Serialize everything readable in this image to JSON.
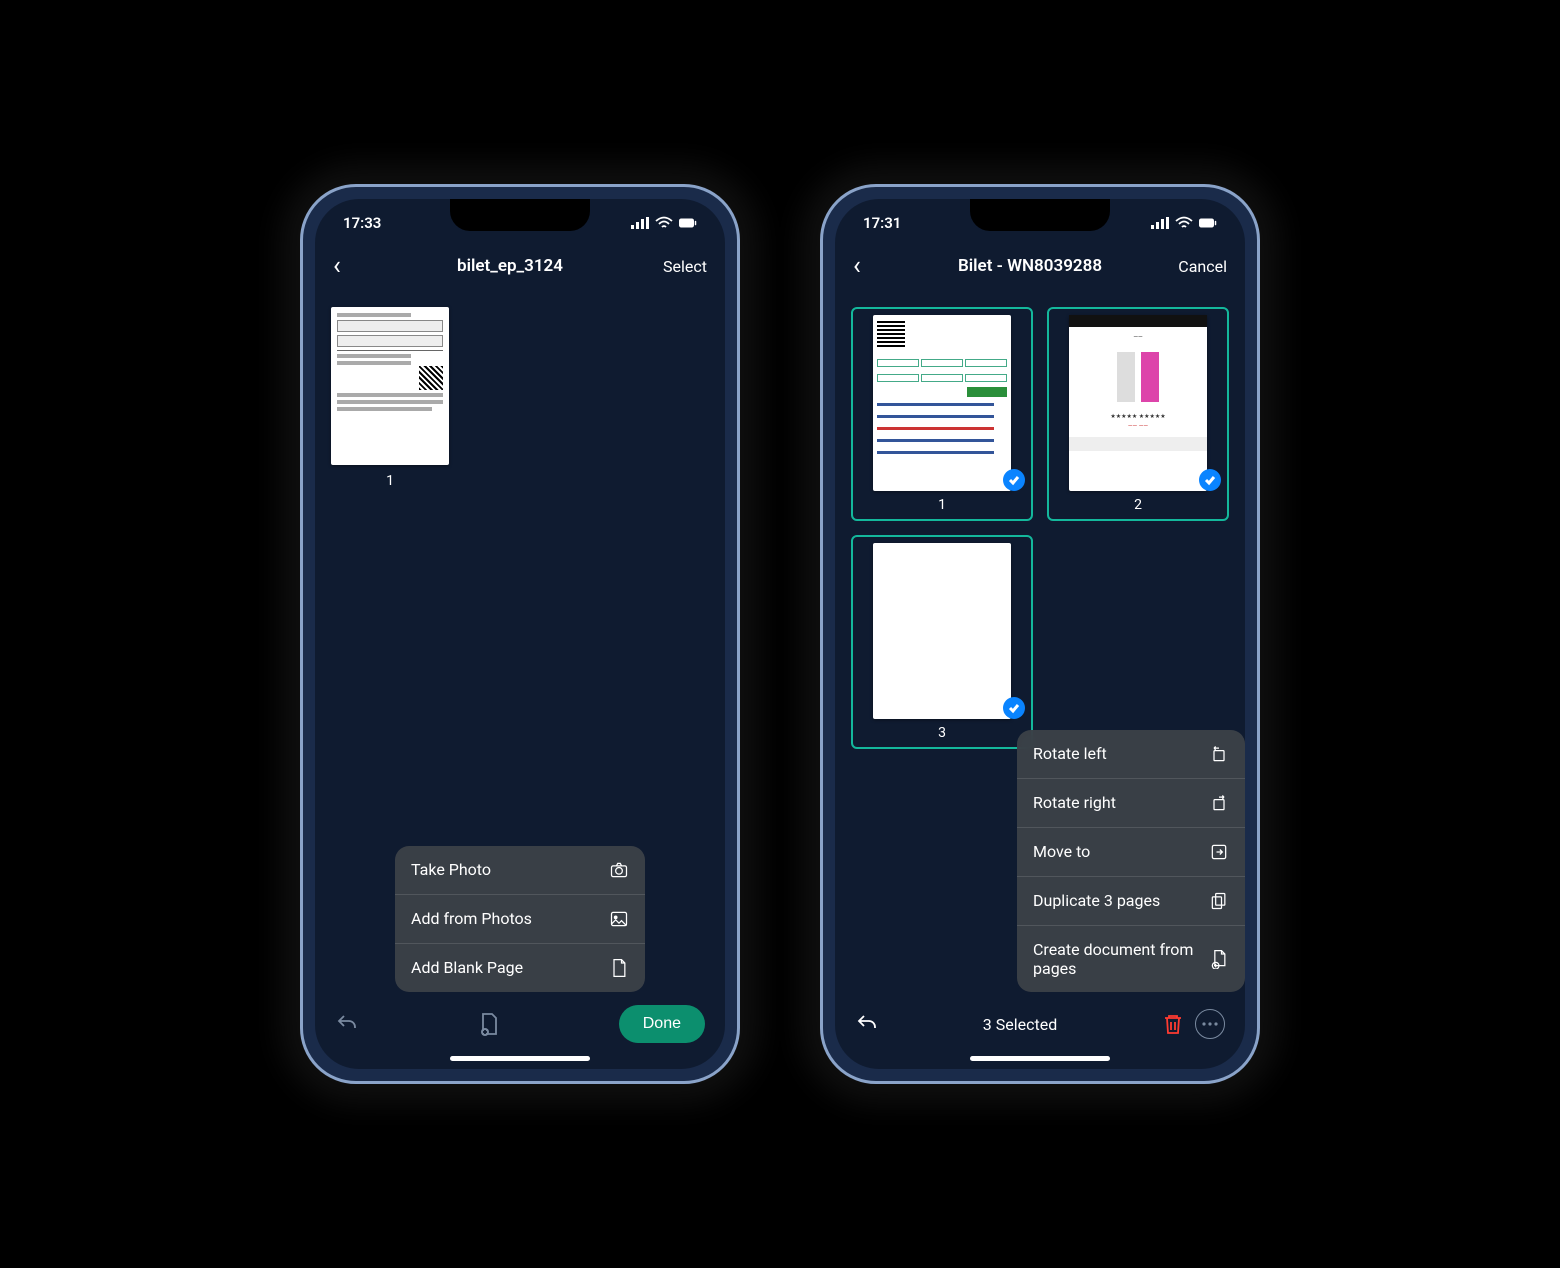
{
  "left": {
    "status": {
      "time": "17:33"
    },
    "nav": {
      "title": "bilet_ep_3124",
      "action": "Select"
    },
    "pages": [
      {
        "index": "1"
      }
    ],
    "popover": {
      "items": [
        {
          "label": "Take Photo",
          "icon": "camera-icon"
        },
        {
          "label": "Add from Photos",
          "icon": "image-icon"
        },
        {
          "label": "Add Blank Page",
          "icon": "page-icon"
        }
      ]
    },
    "toolbar": {
      "done": "Done"
    }
  },
  "right": {
    "status": {
      "time": "17:31"
    },
    "nav": {
      "title": "Bilet - WN8039288",
      "action": "Cancel"
    },
    "pages": [
      {
        "index": "1",
        "selected": true
      },
      {
        "index": "2",
        "selected": true
      },
      {
        "index": "3",
        "selected": true
      }
    ],
    "popover": {
      "items": [
        {
          "label": "Rotate left",
          "icon": "rotate-left-icon"
        },
        {
          "label": "Rotate right",
          "icon": "rotate-right-icon"
        },
        {
          "label": "Move to",
          "icon": "move-icon"
        },
        {
          "label": "Duplicate 3 pages",
          "icon": "duplicate-icon"
        },
        {
          "label": "Create document from pages",
          "icon": "create-doc-icon"
        }
      ]
    },
    "toolbar": {
      "selected_text": "3 Selected"
    }
  }
}
